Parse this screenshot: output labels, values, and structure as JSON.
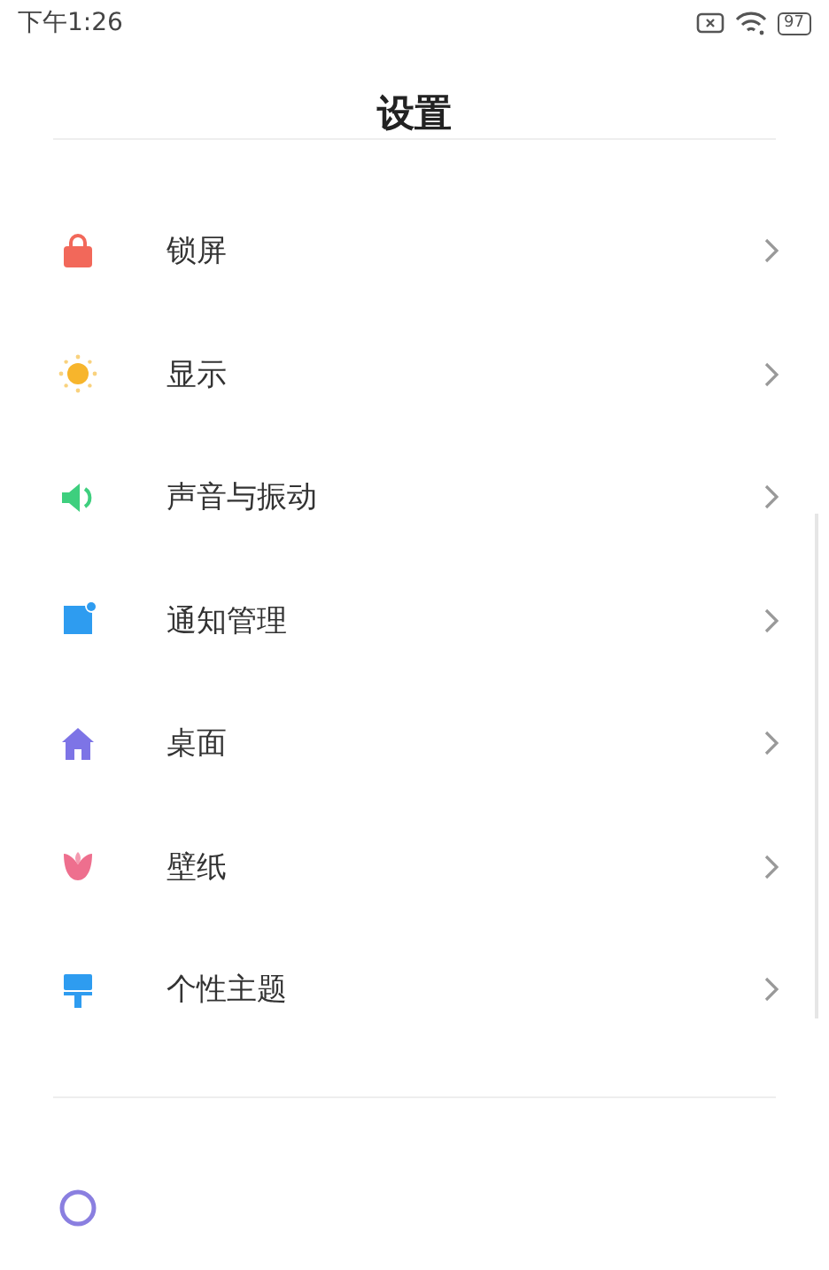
{
  "status_bar": {
    "time": "下午1:26",
    "battery": "97"
  },
  "header": {
    "title": "设置"
  },
  "groups": [
    {
      "items": [
        {
          "kind": "lock",
          "label": "锁屏"
        },
        {
          "kind": "sun",
          "label": "显示"
        },
        {
          "kind": "speaker",
          "label": "声音与振动"
        },
        {
          "kind": "notice",
          "label": "通知管理"
        },
        {
          "kind": "home",
          "label": "桌面"
        },
        {
          "kind": "tulip",
          "label": "壁纸"
        },
        {
          "kind": "brush",
          "label": "个性主题"
        }
      ]
    },
    {
      "items": [
        {
          "kind": "circle"
        }
      ]
    }
  ]
}
